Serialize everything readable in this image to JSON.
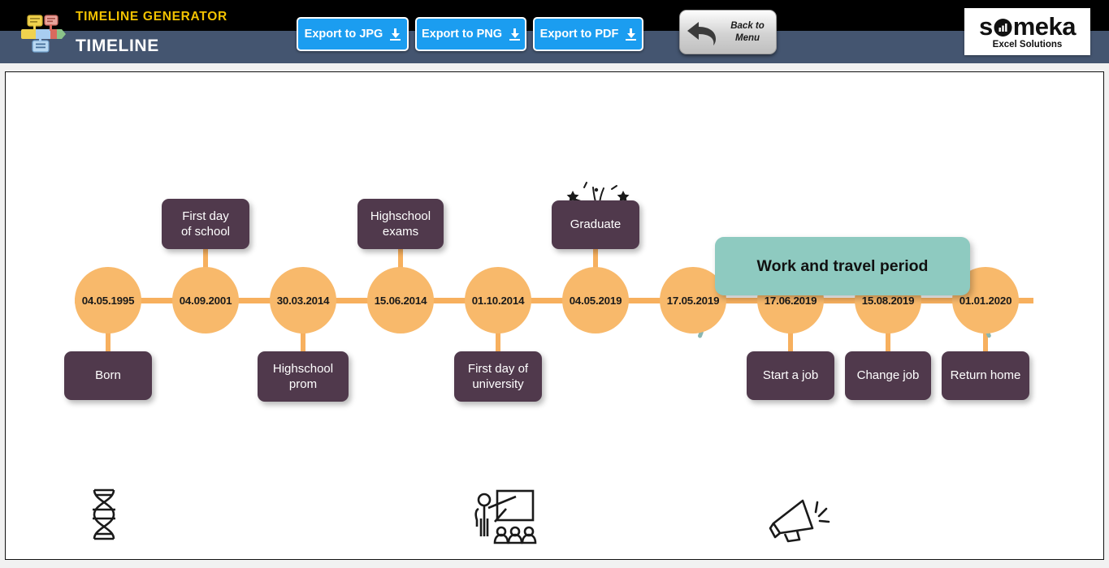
{
  "header": {
    "product_name": "TIMELINE GENERATOR",
    "sheet_title": "TIMELINE",
    "app_logo_icon": "timeline-flow-icon",
    "buttons": {
      "export_jpg": "Export to JPG",
      "export_png": "Export to PNG",
      "export_pdf": "Export to PDF",
      "back_to_menu_line1": "Back to",
      "back_to_menu_line2": "Menu",
      "back_arrow_icon": "back-arrow-icon",
      "download_icon": "download-arrow-icon"
    },
    "brand": {
      "wordmark_before": "s",
      "wordmark_after": "meka",
      "tagline": "Excel Solutions",
      "chart_icon": "bar-chart-icon"
    },
    "colors": {
      "top_band": "#000000",
      "title_band": "#445570",
      "product_name": "#f2c200",
      "export_button": "#1b9df0"
    }
  },
  "timeline": {
    "axis_color": "#f7b05e",
    "node_color": "#f8b96b",
    "box_color": "#50394c",
    "period_color": "#8ecac0",
    "nodes": [
      {
        "date": "04.05.1995",
        "label": "Born",
        "side": "below"
      },
      {
        "date": "04.09.2001",
        "label": "First day\nof school",
        "side": "above"
      },
      {
        "date": "30.03.2014",
        "label": "Highschool\nprom",
        "side": "below"
      },
      {
        "date": "15.06.2014",
        "label": "Highschool\nexams",
        "side": "above"
      },
      {
        "date": "01.10.2014",
        "label": "First day of\nuniversity",
        "side": "below"
      },
      {
        "date": "04.05.2019",
        "label": "Graduate",
        "side": "above"
      },
      {
        "date": "17.05.2019",
        "label": "",
        "side": "none"
      },
      {
        "date": "17.06.2019",
        "label": "Start a job",
        "side": "below"
      },
      {
        "date": "15.08.2019",
        "label": "Change job",
        "side": "below"
      },
      {
        "date": "01.01.2020",
        "label": "Return home",
        "side": "below"
      }
    ],
    "period": {
      "label": "Work and travel period",
      "start_date": "17.05.2019",
      "end_date": "01.01.2020"
    },
    "decorations": [
      {
        "icon": "dna-helix-icon",
        "near": "04.05.1995"
      },
      {
        "icon": "classroom-presentation-icon",
        "near": "01.10.2014"
      },
      {
        "icon": "fireworks-icon",
        "near": "04.05.2019"
      },
      {
        "icon": "megaphone-icon",
        "near": "17.06.2019"
      }
    ]
  }
}
